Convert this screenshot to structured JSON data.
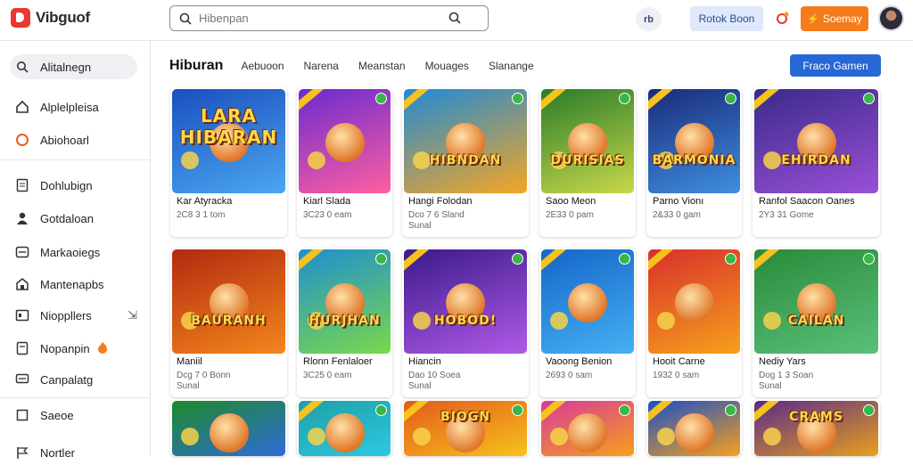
{
  "app": {
    "name": "Vibguof"
  },
  "search": {
    "placeholder": "Hibenpan"
  },
  "header": {
    "notif_label": "rb",
    "light_button": "Rotok Boon",
    "orange_button": "Soemay"
  },
  "sidebar": {
    "items": [
      {
        "label": "Alitalnegn",
        "icon": "search-icon",
        "active": true
      },
      {
        "label": "Alplelpleisa",
        "icon": "home-icon"
      },
      {
        "label": "Abiohoarl",
        "icon": "circle-icon"
      },
      {
        "label": "Dohlubign",
        "icon": "document-icon"
      },
      {
        "label": "Gotdaloan",
        "icon": "user-icon"
      },
      {
        "label": "Markaoiegs",
        "icon": "mail-icon"
      },
      {
        "label": "Mantenapbs",
        "icon": "store-icon"
      },
      {
        "label": "Nioppllers",
        "icon": "gamepad-icon",
        "extra": "⇲"
      },
      {
        "label": "Nopanpin",
        "icon": "tag-icon",
        "extra": "fire"
      },
      {
        "label": "Canpalatg",
        "icon": "chat-icon"
      },
      {
        "label": "Saeoe",
        "icon": "square-icon"
      },
      {
        "label": "Nortler",
        "icon": "flag-icon"
      }
    ]
  },
  "tabs": [
    {
      "label": "Hiburan",
      "active": true
    },
    {
      "label": "Aebuoon"
    },
    {
      "label": "Narena"
    },
    {
      "label": "Meanstan"
    },
    {
      "label": "Mouages"
    },
    {
      "label": "Slanange"
    }
  ],
  "action_button": "Fraco Gamen",
  "cards": [
    {
      "name": "Kar Atyracka",
      "meta1": "2C8 3 1 tom",
      "meta2": "",
      "art": "LARA HIBARAN",
      "bg": [
        "#1b4fbf",
        "#4aa7f0"
      ]
    },
    {
      "name": "Kiarl Slada",
      "meta1": "3C23 0 eam",
      "meta2": "",
      "art": "",
      "bg": [
        "#6a2bd0",
        "#ff5fa0"
      ]
    },
    {
      "name": "Hangi Folodan",
      "meta1": "Dco 7 6 Sland",
      "meta2": "Sunal",
      "art": "HIBNDAN",
      "bg": [
        "#1f8ad6",
        "#f6a623"
      ]
    },
    {
      "name": "Saoo Meon",
      "meta1": "2E33 0 pam",
      "meta2": "",
      "art": "DURISIAS",
      "bg": [
        "#2a7c2a",
        "#c8d84a"
      ]
    },
    {
      "name": "Parno Vionı",
      "meta1": "2&33 0 gam",
      "meta2": "",
      "art": "BARMONIA",
      "bg": [
        "#1a2a7a",
        "#3f8fe0"
      ]
    },
    {
      "name": "Ranfol Saacon Oanes",
      "meta1": "2Y3 31 Gome",
      "meta2": "",
      "art": "EHIRDAN",
      "bg": [
        "#3a2a8a",
        "#9a50d8"
      ]
    },
    {
      "name": "Maniil",
      "meta1": "Dcg 7 0 Bonn",
      "meta2": "Sunal",
      "art": "BAURANH",
      "bg": [
        "#b22a10",
        "#f4861c"
      ]
    },
    {
      "name": "Rlonn Fenlaloer",
      "meta1": "3C25 0 eam",
      "meta2": "",
      "art": "HURJHAN",
      "bg": [
        "#1e8fd0",
        "#7ad84a"
      ]
    },
    {
      "name": "Hiancin",
      "meta1": "Dao 10 Soea",
      "meta2": "Sunal",
      "art": "HOBOD!",
      "bg": [
        "#3a1a8a",
        "#b05ae8"
      ]
    },
    {
      "name": "Vaoong Benion",
      "meta1": "2693 0 sam",
      "meta2": "",
      "art": "",
      "bg": [
        "#1466c8",
        "#46b0f4"
      ]
    },
    {
      "name": "Hooit Carne",
      "meta1": "1932 0 sam",
      "meta2": "",
      "art": "",
      "bg": [
        "#d9302a",
        "#f6a01c"
      ]
    },
    {
      "name": "Nediy Yars",
      "meta1": "Dog 1 3 Soan",
      "meta2": "Sunal",
      "art": "CAILAN",
      "bg": [
        "#2a8a3a",
        "#5ac07a"
      ]
    },
    {
      "name": "",
      "meta1": "",
      "meta2": "",
      "art": "",
      "bg": [
        "#1e8a2a",
        "#2f6bd8"
      ]
    },
    {
      "name": "",
      "meta1": "",
      "meta2": "",
      "art": "",
      "bg": [
        "#1ea0a8",
        "#2fc8e0"
      ]
    },
    {
      "name": "",
      "meta1": "",
      "meta2": "",
      "art": "BIOGN",
      "bg": [
        "#e45a1c",
        "#f6c21c"
      ]
    },
    {
      "name": "",
      "meta1": "",
      "meta2": "",
      "art": "",
      "bg": [
        "#d83a9a",
        "#f6a01c"
      ]
    },
    {
      "name": "",
      "meta1": "",
      "meta2": "",
      "art": "",
      "bg": [
        "#1a4fc8",
        "#f6a01c"
      ]
    },
    {
      "name": "",
      "meta1": "",
      "meta2": "",
      "art": "CRAMS",
      "bg": [
        "#5a2a8a",
        "#e8a01c"
      ]
    }
  ]
}
